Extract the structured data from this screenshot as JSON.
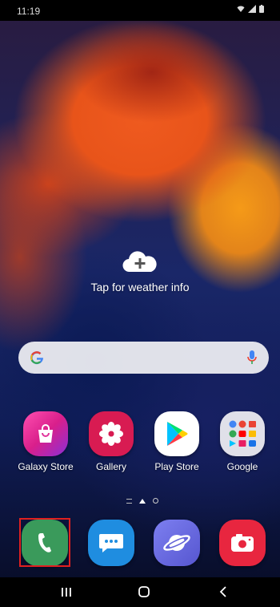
{
  "status_bar": {
    "time": "11:19",
    "icons": [
      "wifi-icon",
      "signal-icon",
      "battery-icon"
    ]
  },
  "weather": {
    "label": "Tap for weather info",
    "icon": "cloud-add-icon"
  },
  "search_bar": {
    "icon_left": "google-g-icon",
    "icon_right": "microphone-icon"
  },
  "home_apps": [
    {
      "label": "Galaxy Store",
      "icon": "galaxy-store-bag-icon"
    },
    {
      "label": "Gallery",
      "icon": "gallery-flower-icon"
    },
    {
      "label": "Play Store",
      "icon": "play-store-icon"
    },
    {
      "label": "Google",
      "icon": "google-folder-icon"
    }
  ],
  "dock_apps": [
    {
      "icon": "phone-icon",
      "highlighted": true
    },
    {
      "icon": "messages-icon"
    },
    {
      "icon": "internet-planet-icon"
    },
    {
      "icon": "camera-icon"
    }
  ],
  "nav_bar": [
    "recent-apps-icon",
    "home-icon",
    "back-icon"
  ],
  "colors": {
    "phone": "#3a9a5b",
    "messages": "#1f8de0",
    "internet": "#6c6fe0",
    "camera": "#e8263f",
    "gallery": "#d81b52",
    "highlight": "#e02020"
  }
}
